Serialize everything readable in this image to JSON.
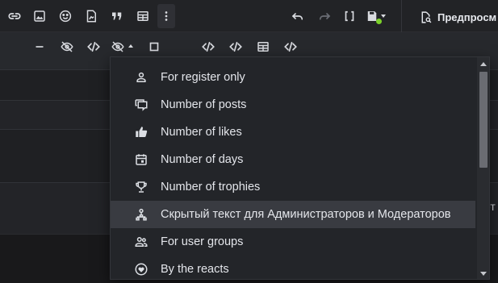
{
  "toolbar": {
    "primary_icons": [
      "link-icon",
      "image-icon",
      "smiley-icon",
      "media-icon",
      "quote-icon",
      "table-icon",
      "more-vertical-icon"
    ],
    "history_icons": [
      "undo-icon",
      "redo-icon",
      "brackets-icon",
      "save-draft-icon"
    ],
    "preview_label": "Предпросм",
    "save_status_color": "#7bd12a"
  },
  "toolbar2": {
    "icons": [
      "minus-icon",
      "eye-off-icon",
      "code-icon",
      "hide-dropdown-icon",
      "square-icon",
      "code-icon",
      "code-icon",
      "table-icon",
      "code-icon"
    ]
  },
  "background": {
    "clipped_text": "ет"
  },
  "dropdown": {
    "highlight_color": "#393b41",
    "items": [
      {
        "label": "For register only",
        "icon": "person-icon"
      },
      {
        "label": "Number of posts",
        "icon": "comments-icon"
      },
      {
        "label": "Number of likes",
        "icon": "thumbs-up-icon"
      },
      {
        "label": "Number of days",
        "icon": "calendar-icon"
      },
      {
        "label": "Number of trophies",
        "icon": "trophy-icon"
      },
      {
        "label": "Скрытый текст для Администраторов и Модераторов",
        "icon": "user-hierarchy-icon",
        "highlighted": true
      },
      {
        "label": "For user groups",
        "icon": "user-group-icon"
      },
      {
        "label": "By the reacts",
        "icon": "heart-badge-icon"
      }
    ]
  }
}
